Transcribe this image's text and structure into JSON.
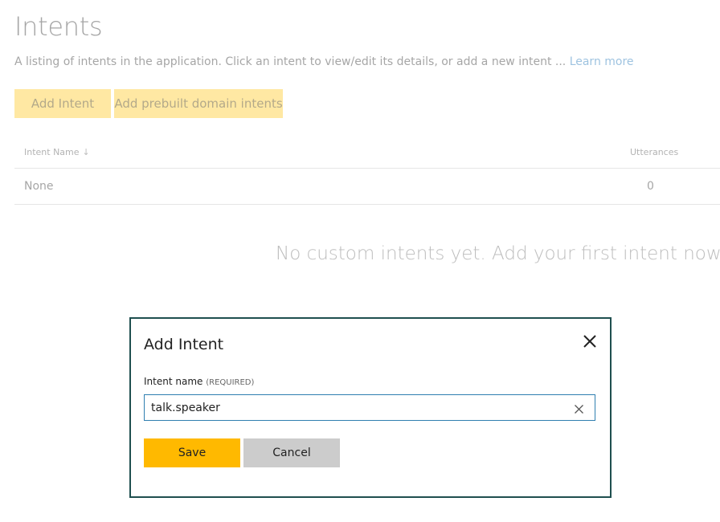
{
  "page": {
    "title": "Intents",
    "description": "A listing of intents in the application. Click an intent to view/edit its details, or add a new intent ... ",
    "learn_more": "Learn more",
    "buttons": {
      "add_intent": "Add Intent",
      "add_prebuilt": "Add prebuilt domain intents"
    }
  },
  "table": {
    "columns": {
      "name": "Intent Name",
      "sort_icon": "↓",
      "utterances": "Utterances"
    },
    "rows": [
      {
        "name": "None",
        "utterances": "0"
      }
    ],
    "empty_message": "No custom intents yet. Add your first intent now."
  },
  "modal": {
    "title": "Add Intent",
    "field_label": "Intent name",
    "field_required": "(REQUIRED)",
    "field_value": "talk.speaker",
    "save_label": "Save",
    "cancel_label": "Cancel",
    "icons": {
      "close": "close-icon",
      "clear": "clear-icon"
    }
  },
  "colors": {
    "save_button": "#ffb900",
    "cancel_button": "#cccccc",
    "modal_border": "#1f4f4f",
    "input_border": "#2f7fb0"
  }
}
